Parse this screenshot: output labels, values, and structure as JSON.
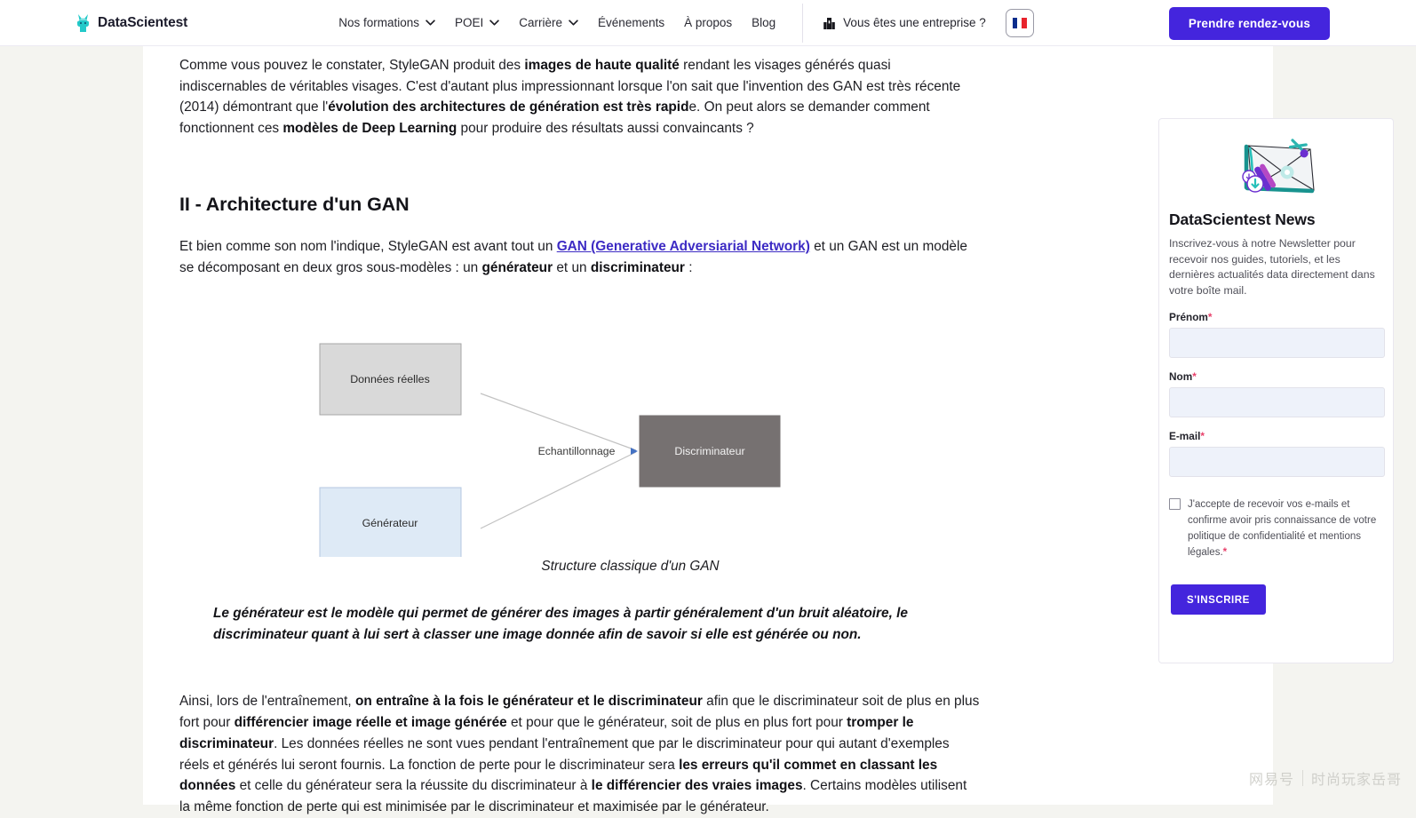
{
  "header": {
    "logo_text": "DataScientest",
    "logo_icon": "rabbit-logo-icon",
    "nav": [
      {
        "label": "Nos formations",
        "has_dropdown": true
      },
      {
        "label": "POEI",
        "has_dropdown": true
      },
      {
        "label": "Carrière",
        "has_dropdown": true
      },
      {
        "label": "Événements",
        "has_dropdown": false
      },
      {
        "label": "À propos",
        "has_dropdown": false
      },
      {
        "label": "Blog",
        "has_dropdown": false
      }
    ],
    "enterprise_label": "Vous êtes une entreprise ?",
    "enterprise_icon": "building-icon",
    "language_flag": "fr-flag-icon",
    "cta_label": "Prendre rendez-vous",
    "accent_color": "#4425dd"
  },
  "article": {
    "intro": {
      "p1_a": "Comme vous pouvez le constater, StyleGAN produit des ",
      "p1_b1": "images de haute qualité",
      "p1_c": " rendant les visages générés quasi indiscernables de véritables visages. C'est d'autant plus impressionnant lorsque l'on sait que l'invention des GAN est très récente (2014) démontrant que l'",
      "p1_b2": "évolution des architectures de génération est très rapid",
      "p1_d": "e. On peut alors se demander comment fonctionnent ces ",
      "p1_b3": "modèles de Deep Learning",
      "p1_e": " pour produire des résultats aussi convaincants ?"
    },
    "section_title": "II - Architecture d'un GAN",
    "section_intro": {
      "a": "Et bien comme son nom l'indique, StyleGAN est avant tout un ",
      "link": "GAN (Generative Adversiarial Network)",
      "b": " et un GAN est un modèle se décomposant en deux gros sous-modèles : un ",
      "bold1": "générateur",
      "c": " et un ",
      "bold2": "discriminateur",
      "d": " :"
    },
    "quote": "Le générateur est le modèle qui permet de générer des images à partir généralement d'un bruit aléatoire, le discriminateur quant à lui sert à classer une image donnée afin de savoir si elle est générée ou non.",
    "closing": {
      "a": "Ainsi, lors de l'entraînement, ",
      "b1": "on entraîne à la fois le générateur et le discriminateur",
      "c": " afin que le discriminateur soit de plus en plus fort pour ",
      "b2": "différencier image réelle et image générée",
      "d": " et pour que le générateur, soit de plus en plus fort pour ",
      "b3": "tromper le discriminateur",
      "e": ". Les données réelles ne sont vues pendant l'entraînement que par le discriminateur pour qui autant d'exemples réels et générés lui seront fournis. La fonction de perte pour le discriminateur sera ",
      "b4": "les erreurs qu'il commet en classant les données",
      "f": " et celle du générateur sera la réussite du discriminateur à ",
      "b5": "le différencier des vraies images",
      "g": ". Certains modèles utilisent la même fonction de perte qui est minimisée par le discriminateur et maximisée par le générateur."
    }
  },
  "diagram": {
    "caption": "Structure classique d'un GAN",
    "nodes": [
      {
        "id": "real-data",
        "label": "Données réelles",
        "fill": "#d9d9d9",
        "stroke": "#a6a6a6"
      },
      {
        "id": "generator",
        "label": "Générateur",
        "fill": "#deeaf6",
        "stroke": "#b4c7e0"
      },
      {
        "id": "discriminator",
        "label": "Discriminateur",
        "fill": "#767171",
        "stroke": "#767171"
      }
    ],
    "edge_label": "Echantillonnage"
  },
  "newsletter": {
    "icon": "envelope-newsletter-icon",
    "title": "DataScientest News",
    "description": "Inscrivez-vous à notre Newsletter pour recevoir nos guides, tutoriels, et les dernières actualités data directement dans votre boîte mail.",
    "fields": [
      {
        "label": "Prénom",
        "required": true,
        "value": "",
        "placeholder": ""
      },
      {
        "label": "Nom",
        "required": true,
        "value": "",
        "placeholder": ""
      },
      {
        "label": "E-mail",
        "required": true,
        "value": "",
        "placeholder": ""
      }
    ],
    "consent_text": "J'accepte de recevoir vos e-mails et confirme avoir pris connaissance de votre politique de confidentialité et mentions légales.",
    "consent_required_mark": "*",
    "consent_checked": false,
    "submit_label": "S'INSCRIRE",
    "required_mark": "*"
  },
  "watermark": {
    "brand": "网易号",
    "account": "时尚玩家岳哥"
  }
}
